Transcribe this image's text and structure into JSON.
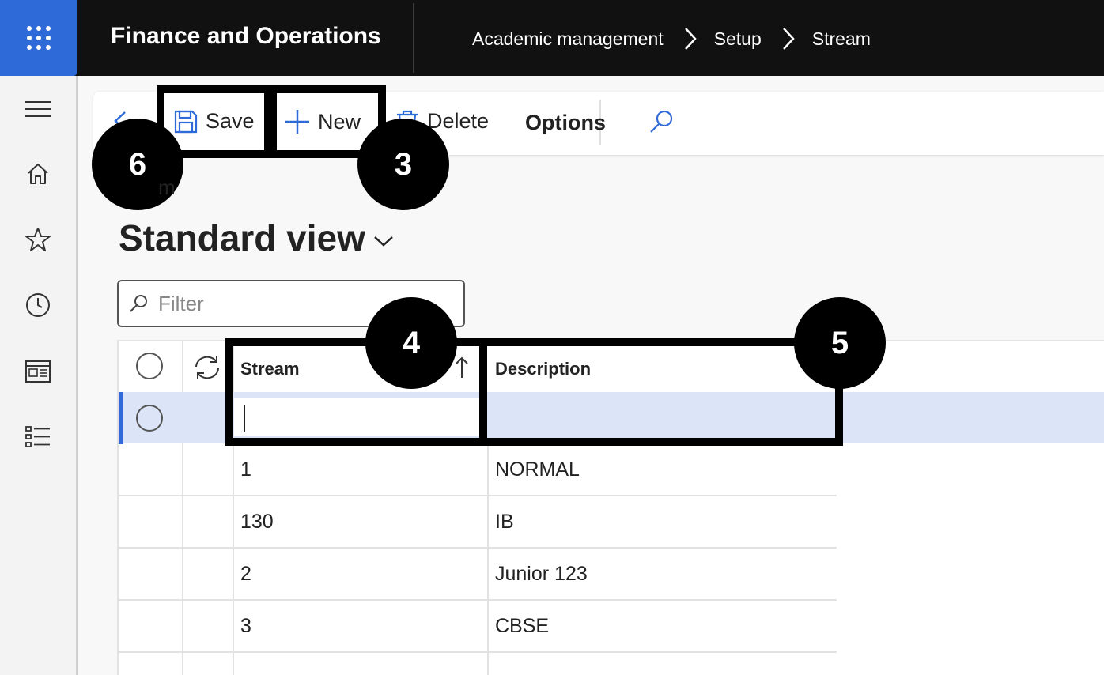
{
  "app": {
    "title": "Finance and Operations"
  },
  "breadcrumb": [
    "Academic management",
    "Setup",
    "Stream"
  ],
  "actions": {
    "save": "Save",
    "new": "New",
    "delete": "Delete",
    "options": "Options"
  },
  "page": {
    "title_partial": "m",
    "view": "Standard view"
  },
  "filter": {
    "placeholder": "Filter",
    "value": ""
  },
  "grid": {
    "columns": {
      "stream": "Stream",
      "description": "Description"
    },
    "rows": [
      {
        "stream": "",
        "description": "",
        "selected": true
      },
      {
        "stream": "1",
        "description": "NORMAL"
      },
      {
        "stream": "130",
        "description": "IB"
      },
      {
        "stream": "2",
        "description": "Junior 123"
      },
      {
        "stream": "3",
        "description": "CBSE"
      }
    ]
  },
  "callouts": {
    "six": "6",
    "three": "3",
    "four": "4",
    "five": "5"
  },
  "colors": {
    "accent": "#2f6ad9",
    "topbar": "#111111",
    "selected_row": "#dbe5f7"
  },
  "icons": [
    "waffle-icon",
    "chevron-right-icon",
    "hamburger-icon",
    "home-icon",
    "star-icon",
    "clock-icon",
    "workspace-icon",
    "list-icon",
    "back-arrow-icon",
    "save-icon",
    "plus-icon",
    "trash-icon",
    "search-icon",
    "chevron-down-icon",
    "refresh-icon",
    "sort-ascending-icon"
  ]
}
